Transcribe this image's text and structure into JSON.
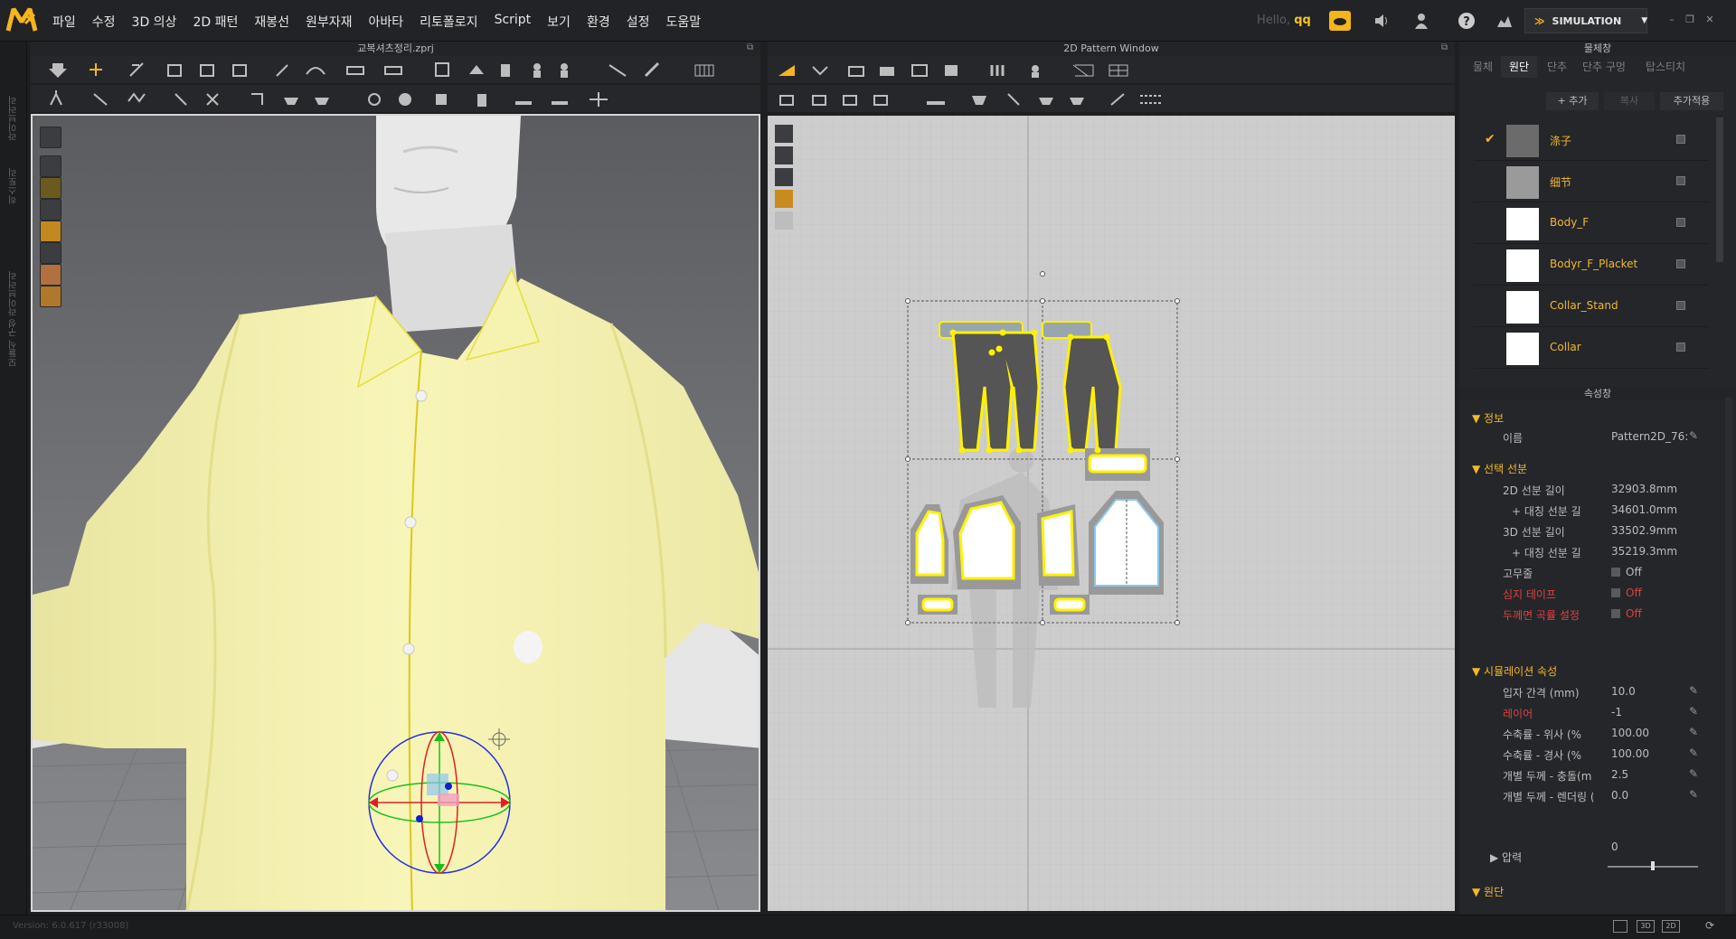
{
  "app": {
    "menu": [
      "파일",
      "수정",
      "3D 의상",
      "2D 패턴",
      "재봉선",
      "원부자재",
      "아바타",
      "리토폴로지",
      "Script",
      "보기",
      "환경",
      "설정",
      "도움말"
    ],
    "hello_prefix": "Hello,",
    "user": "qq",
    "simulation_label": "SIMULATION"
  },
  "left_strip": {
    "labels": [
      "라이브러리",
      "히스토리",
      "모듈식 구성 라이브러리"
    ]
  },
  "viewport3d": {
    "title": "교복셔츠정리.zprj"
  },
  "viewport2d": {
    "title": "2D Pattern Window"
  },
  "object_browser": {
    "title": "물체창",
    "tabs": [
      "물체",
      "원단",
      "단추",
      "단추 구멍",
      "탑스티치"
    ],
    "active_tab": 1,
    "add_label": "+ 추가",
    "copy_label": "복사",
    "apply_label": "추가적용",
    "fabrics": [
      {
        "name": "涤子",
        "color": "#6b6b6b",
        "checked": true
      },
      {
        "name": "细节",
        "color": "#9a9a9a",
        "checked": false
      },
      {
        "name": "Body_F",
        "color": "#ffffff",
        "checked": false
      },
      {
        "name": "Bodyr_F_Placket",
        "color": "#ffffff",
        "checked": false
      },
      {
        "name": "Collar_Stand",
        "color": "#ffffff",
        "checked": false
      },
      {
        "name": "Collar",
        "color": "#ffffff",
        "checked": false
      }
    ]
  },
  "properties": {
    "title": "속성창",
    "sections": {
      "info": "정보",
      "selected_line": "선택 선분",
      "simulation": "시뮬레이션 속성",
      "pressure": "압력",
      "fabric": "원단"
    },
    "rows": [
      {
        "label": "이름",
        "value": "Pattern2D_76:",
        "color": "normal",
        "edit": true
      },
      {
        "label": "2D 선분 길이",
        "value": "32903.8mm",
        "color": "normal",
        "edit": false
      },
      {
        "label": "+ 대칭 선분 길",
        "value": "34601.0mm",
        "color": "normal",
        "edit": false
      },
      {
        "label": "3D 선분 길이",
        "value": "33502.9mm",
        "color": "normal",
        "edit": false
      },
      {
        "label": "+ 대칭 선분 길",
        "value": "35219.3mm",
        "color": "normal",
        "edit": false
      },
      {
        "label": "고무줄",
        "value": "Off",
        "color": "normal",
        "edit": false,
        "check": true
      },
      {
        "label": "심지 테이프",
        "value": "Off",
        "color": "red",
        "edit": false,
        "check": true
      },
      {
        "label": "두께면 곡률 설정",
        "value": "Off",
        "color": "red",
        "edit": false,
        "check": true
      },
      {
        "label": "입자 간격 (mm)",
        "value": "10.0",
        "color": "normal",
        "edit": true
      },
      {
        "label": "레이어",
        "value": "-1",
        "color": "red",
        "edit": true
      },
      {
        "label": "수축률 - 위사 (%",
        "value": "100.00",
        "color": "normal",
        "edit": true
      },
      {
        "label": "수축률 - 경사 (%",
        "value": "100.00",
        "color": "normal",
        "edit": true
      },
      {
        "label": "개별 두께 - 충돌(m",
        "value": "2.5",
        "color": "normal",
        "edit": true
      },
      {
        "label": "개별 두께 - 렌더링 (",
        "value": "0.0",
        "color": "normal",
        "edit": true
      }
    ],
    "pressure_value": "0"
  },
  "status": {
    "version": "Version: 6.0.617 (r33008)"
  },
  "colors": {
    "accent": "#f2b92a",
    "red": "#e04040",
    "shirt": "#f4f0a8",
    "select": "#fff200"
  }
}
